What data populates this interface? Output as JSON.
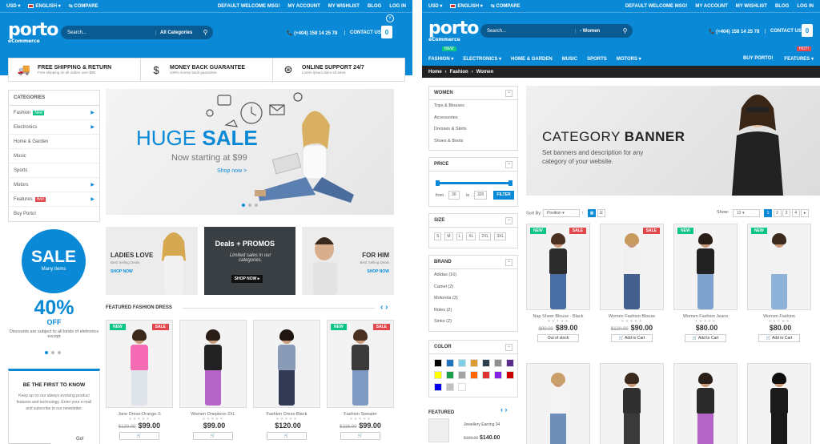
{
  "colors": {
    "primary": "#0a8ad6",
    "new_label": "#0cc485",
    "sale_label": "#e2474c"
  },
  "left": {
    "topbar": {
      "currency": "USD ▾",
      "language": "ENGLISH ▾",
      "compare": "⇆ COMPARE",
      "welcome": "DEFAULT WELCOME MSG!",
      "account": "MY ACCOUNT",
      "wishlist": "MY WISHLIST",
      "blog": "BLOG",
      "login": "LOG IN"
    },
    "logo": {
      "name": "porto",
      "sub": "eCommerce"
    },
    "search": {
      "placeholder": "Search...",
      "category": "All Categories"
    },
    "phone": "📞 (+404) 158 14 25 78",
    "contact": "CONTACT US",
    "features": [
      {
        "icon": "truck-icon",
        "glyph": "🚚",
        "title": "FREE SHIPPING & RETURN",
        "sub": "Free shipping on all orders over $99."
      },
      {
        "icon": "dollar-icon",
        "glyph": "$",
        "title": "MONEY BACK GUARANTEE",
        "sub": "100% money back guarantee."
      },
      {
        "icon": "lifebuoy-icon",
        "glyph": "⊛",
        "title": "ONLINE SUPPORT 24/7",
        "sub": "Lorem ipsum dolor sit amet."
      }
    ],
    "categories": {
      "title": "CATEGORIES",
      "items": [
        {
          "label": "Fashion",
          "tag": "New",
          "arrow": true
        },
        {
          "label": "Electronics",
          "arrow": true
        },
        {
          "label": "Home & Garden"
        },
        {
          "label": "Music"
        },
        {
          "label": "Sports"
        },
        {
          "label": "Motors",
          "arrow": true
        },
        {
          "label": "Features",
          "tag": "Hot!",
          "arrow": true
        },
        {
          "label": "Buy Porto!"
        }
      ]
    },
    "hero": {
      "title_bold": "HUGE",
      "title_light": "SALE",
      "sub": "Now starting at $99",
      "link": "Shop now >"
    },
    "banners": [
      {
        "title": "LADIES LOVE",
        "sub": "Best Selling Deals",
        "link": "SHOP NOW"
      },
      {
        "title": "Deals + PROMOS",
        "sub": "Limited sales in our categories.",
        "link": "SHOP NOW ▸"
      },
      {
        "title": "FOR HIM",
        "sub": "Best Selling Deals",
        "link": "SHOP NOW"
      }
    ],
    "sale": {
      "big": "SALE",
      "small": "Many items",
      "percent": "40%",
      "off": "OFF",
      "desc": "Discounts are subject to all kinds of eletronics except"
    },
    "newsletter": {
      "title": "BE THE FIRST TO KNOW",
      "desc": "Keep up on our always evolving product features and technology. Enter your e-mail and subscribe to our newsletter.",
      "go": "Go!"
    },
    "featured_title": "FEATURED FASHION DRESS",
    "products": [
      {
        "name": "Jane Dress-Orange-S",
        "old": "$120.00",
        "price": "$99.00",
        "new": true,
        "sale": true,
        "shirt": "#f56bb4",
        "pants": "#dfe4ea",
        "hair": "#3a2a1d"
      },
      {
        "name": "Women Onepiece-2XL",
        "old": "",
        "price": "$99.00",
        "new": false,
        "sale": false,
        "shirt": "#222",
        "pants": "#b565c8",
        "hair": "#2a1e18"
      },
      {
        "name": "Fashion Dress-Black",
        "old": "",
        "price": "$120.00",
        "new": false,
        "sale": false,
        "shirt": "#8a9bb8",
        "pants": "#313a52",
        "hair": "#1f1611"
      },
      {
        "name": "Fashion Sweater",
        "old": "$118.00",
        "price": "$99.00",
        "new": true,
        "sale": true,
        "shirt": "#3b3b3b",
        "pants": "#7e99c2",
        "hair": "#4a3021"
      }
    ]
  },
  "right": {
    "topbar": {
      "currency": "USD ▾",
      "language": "ENGLISH ▾",
      "compare": "⇆ COMPARE",
      "welcome": "DEFAULT WELCOME MSG!",
      "account": "MY ACCOUNT",
      "wishlist": "MY WISHLIST",
      "blog": "BLOG",
      "login": "LOG IN"
    },
    "logo": {
      "name": "porto",
      "sub": "eCommerce"
    },
    "search": {
      "placeholder": "Search...",
      "category": "- Women"
    },
    "phone": "📞 (+404) 158 14 25 78",
    "contact": "CONTACT US",
    "nav": [
      "FASHION ▾",
      "ELECTRONICS ▾",
      "HOME & GARDEN",
      "MUSIC",
      "SPORTS",
      "MOTORS ▾"
    ],
    "nav_right": [
      "BUY PORTO!",
      "FEATURES ▾"
    ],
    "new_tag": "NEW",
    "hot_tag": "HOT!",
    "breadcrumb": [
      "Home",
      "Fashion",
      "Women"
    ],
    "women": {
      "title": "WOMEN",
      "items": [
        "Tops & Blouses",
        "Accessories",
        "Dresses & Skirts",
        "Shoes & Boots"
      ]
    },
    "price": {
      "title": "PRICE",
      "from_label": "from",
      "from": "30",
      "to_label": "to",
      "to": "320",
      "btn": "FILTER"
    },
    "size": {
      "title": "SIZE",
      "items": [
        "S",
        "M",
        "L",
        "XL",
        "2XL",
        "3XL"
      ]
    },
    "brand": {
      "title": "BRAND",
      "items": [
        "Adidas (16)",
        "Camel (2)",
        "Motorola (3)",
        "Rolex (2)",
        "Sinko (2)"
      ]
    },
    "color": {
      "title": "COLOR",
      "swatches": [
        "#000000",
        "#1e73be",
        "#7ed0e8",
        "#dd9933",
        "#2c3e50",
        "#8e8e8e",
        "#5b2c8f",
        "#ffff00",
        "#1e9e4f",
        "#a3a3a3",
        "#ff6600",
        "#dd3333",
        "#8224e3",
        "#cc0000",
        "#0000ee",
        "#c0c0c0",
        "#ffffff"
      ]
    },
    "featured": {
      "title": "FEATURED",
      "item": "Jewellery Earring 34",
      "old": "$199.00",
      "price": "$140.00"
    },
    "banner": {
      "title_light": "CATEGORY",
      "title_bold": "BANNER",
      "desc": "Set banners and description for any category of your website."
    },
    "sort": {
      "label": "Sort By:",
      "value": "Position",
      "show_label": "Show:",
      "show": "12",
      "pages": [
        "1",
        "2",
        "3",
        "4",
        "▸"
      ]
    },
    "products": [
      {
        "name": "Nap Sheer Blouse - Black",
        "old": "$99.00",
        "price": "$89.00",
        "btn": "Out of stock",
        "new": true,
        "sale": true,
        "shirt": "#2c2c2c",
        "pants": "#4a6fa5",
        "hair": "#4a3021"
      },
      {
        "name": "Women Fashion Blouse",
        "old": "$120.00",
        "price": "$90.00",
        "btn": "🛒 Add to Cart",
        "new": false,
        "sale": true,
        "shirt": "#f0f0f0",
        "pants": "#425f8e",
        "hair": "#c79a5e"
      },
      {
        "name": "Women Fashion Jeans",
        "old": "",
        "price": "$80.00",
        "btn": "🛒 Add to Cart",
        "new": true,
        "sale": false,
        "shirt": "#222",
        "pants": "#7fa3cf",
        "hair": "#2a1e18"
      },
      {
        "name": "Women Fashion",
        "old": "",
        "price": "$80.00",
        "btn": "🛒 Add to Cart",
        "new": true,
        "sale": false,
        "shirt": "#f2f2f2",
        "pants": "#8fb2d8",
        "hair": "#3a2a1d"
      }
    ],
    "products_row2": [
      {
        "shirt": "#f4f4f4",
        "pants": "#6f8fb8",
        "hair": "#c9a06a"
      },
      {
        "shirt": "#303030",
        "pants": "#3a3a3a",
        "hair": "#3a2a1d"
      },
      {
        "shirt": "#2a2a2a",
        "pants": "#b565c8",
        "hair": "#2a1e18"
      },
      {
        "shirt": "#1a1a1a",
        "pants": "#1a1a1a",
        "hair": "#0f0f0f"
      }
    ]
  }
}
